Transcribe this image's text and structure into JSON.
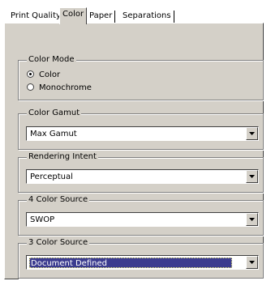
{
  "tabs": [
    {
      "label": "Print Quality",
      "active": false
    },
    {
      "label": "Color",
      "active": true
    },
    {
      "label": "Paper",
      "active": false
    },
    {
      "label": "Separations",
      "active": false
    }
  ],
  "color_mode": {
    "legend": "Color Mode",
    "options": [
      {
        "label": "Color",
        "selected": true
      },
      {
        "label": "Monochrome",
        "selected": false
      }
    ]
  },
  "color_gamut": {
    "legend": "Color Gamut",
    "value": "Max Gamut"
  },
  "rendering_intent": {
    "legend": "Rendering Intent",
    "value": "Perceptual"
  },
  "four_color_source": {
    "legend": "4 Color Source",
    "value": "SWOP"
  },
  "three_color_source": {
    "legend": "3 Color Source",
    "value": "Document Defined",
    "focused": true
  },
  "colors": {
    "panel": "#d4d0c8",
    "selection": "#3b3b8f"
  }
}
